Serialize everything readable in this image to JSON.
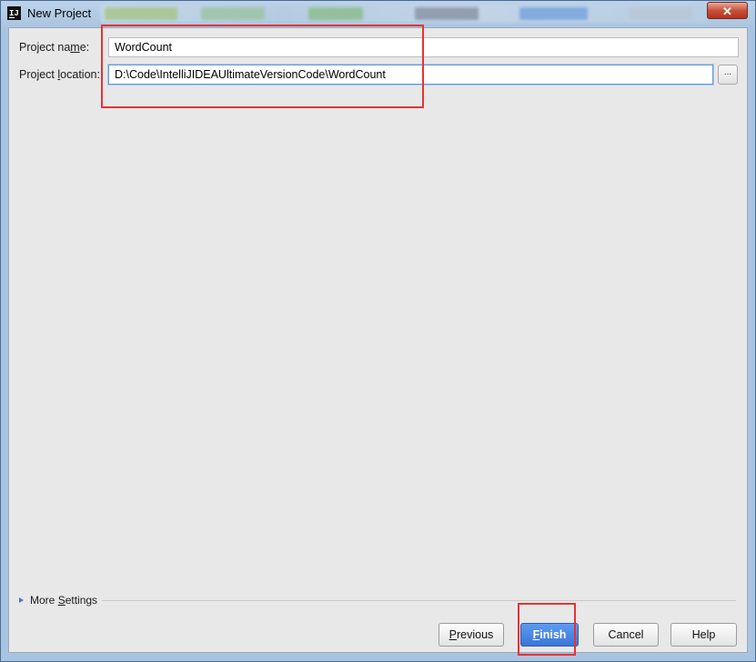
{
  "window": {
    "title": "New Project",
    "app_icon_text": "IJ",
    "close_label": "✕"
  },
  "form": {
    "name_label_pre": "Project na",
    "name_label_mnemonic": "m",
    "name_label_post": "e:",
    "name_value": "WordCount",
    "location_label_pre": "Project ",
    "location_label_mnemonic": "l",
    "location_label_post": "ocation:",
    "location_value": "D:\\Code\\IntelliJIDEAUltimateVersionCode\\WordCount",
    "browse_label": "..."
  },
  "more_settings": {
    "pre": "More",
    "space": " ",
    "mnemonic": "S",
    "post": "ettings"
  },
  "buttons": {
    "previous_mnemonic": "P",
    "previous_rest": "revious",
    "finish_mnemonic": "F",
    "finish_rest": "inish",
    "cancel": "Cancel",
    "help": "Help"
  },
  "colors": {
    "annotation": "#e53333",
    "primary": "#3a76d8"
  }
}
